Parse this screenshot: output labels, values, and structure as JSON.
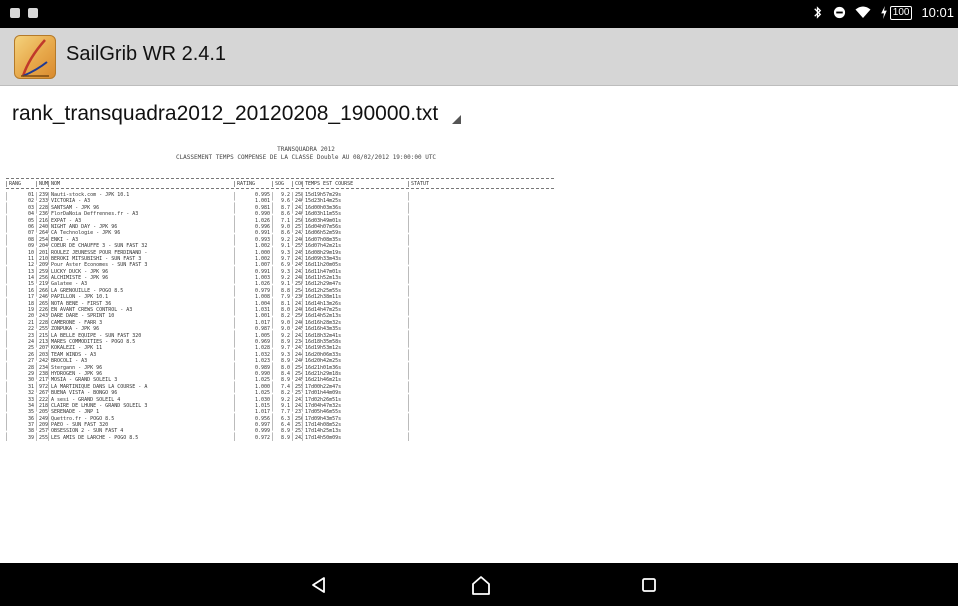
{
  "status_bar": {
    "battery": "100",
    "time": "10:01",
    "icons": [
      "notification-icon",
      "notification-icon",
      "bluetooth-icon",
      "do-not-disturb-icon",
      "wifi-icon",
      "charging-icon"
    ]
  },
  "app": {
    "title": "SailGrib WR 2.4.1",
    "icon": "sailgrib-logo-icon"
  },
  "file_selector": {
    "selected": "rank_transquadra2012_20120208_190000.txt"
  },
  "document": {
    "header": {
      "line1": "TRANSQUADRA 2012",
      "line2": "CLASSEMENT TEMPS COMPENSE DE LA CLASSE Double AU 08/02/2012 19:00:00 UTC"
    },
    "columns": [
      "RANG",
      "NUM",
      "NOM",
      "RATING",
      "SOG",
      "COG",
      "TEMPS EST COURSE",
      "STATUT"
    ],
    "rows": [
      [
        "01",
        "239",
        "Nauti-stock.com     - JPK 10.1",
        "0.995",
        "9.2",
        "258",
        "15d19h57m29s",
        ""
      ],
      [
        "02",
        "233",
        "VICTORIA   - A3",
        "1.001",
        "9.6",
        "246",
        "15d23h14m25s",
        ""
      ],
      [
        "03",
        "228",
        "SANTSAM   - JPK 96",
        "0.981",
        "8.7",
        "243",
        "16d00h03m36s",
        ""
      ],
      [
        "04",
        "236",
        "FlorDaNoia Deffrennes.fr - A3",
        "0.990",
        "8.6",
        "240",
        "16d03h11m55s",
        ""
      ],
      [
        "05",
        "216",
        "EXPAT   - A3",
        "1.026",
        "7.1",
        "250",
        "16d03h49m01s",
        ""
      ],
      [
        "06",
        "240",
        "NIGHT AND DAY   - JPK 96",
        "0.996",
        "9.0",
        "257",
        "16d04h07m56s",
        ""
      ],
      [
        "07",
        "264",
        "CA Technologie - JPK 96",
        "0.991",
        "8.6",
        "242",
        "16d06h52m59s",
        ""
      ],
      [
        "08",
        "254",
        "ENKI   - A3",
        "0.993",
        "9.2",
        "246",
        "16d07h08m35s",
        ""
      ],
      [
        "09",
        "204",
        "COEUR DE CHAUFFE 3 - SUN FAST 32",
        "1.002",
        "9.1",
        "255",
        "16d07h42m21s",
        ""
      ],
      [
        "10",
        "201",
        "ROULEZ JEUNESSE POUR FERDINAND -",
        "1.000",
        "9.3",
        "245",
        "16d08h29m19s",
        ""
      ],
      [
        "11",
        "210",
        "BEROKI MITSUBISHI   - SUN FAST 3",
        "1.002",
        "9.7",
        "243",
        "16d09h33m43s",
        ""
      ],
      [
        "12",
        "209",
        "Pour Aster Economes - SUN FAST 3",
        "1.007",
        "6.9",
        "245",
        "16d11h20m05s",
        ""
      ],
      [
        "13",
        "259",
        "LUCKY DUCK - JPK 96",
        "0.991",
        "9.3",
        "243",
        "16d11h47m01s",
        ""
      ],
      [
        "14",
        "256",
        "ALCHIMISTE   - JPK 96",
        "1.003",
        "9.2",
        "248",
        "16d11h52m13s",
        ""
      ],
      [
        "15",
        "219",
        "Galatee   - A3",
        "1.026",
        "9.1",
        "258",
        "16d12h29m47s",
        ""
      ],
      [
        "16",
        "266",
        "LA GRENOUILLE - POGO 8.5",
        "0.979",
        "8.8",
        "254",
        "16d12h25m55s",
        ""
      ],
      [
        "17",
        "246",
        "PAPILLON   - JPK 10.1",
        "1.008",
        "7.9",
        "236",
        "16d12h38m11s",
        ""
      ],
      [
        "18",
        "265",
        "NOTA BENE - FIRST 36",
        "1.004",
        "8.1",
        "241",
        "16d14h13m26s",
        ""
      ],
      [
        "19",
        "226",
        "EN AVANT CREWS CONTROL - A3",
        "1.031",
        "8.0",
        "240",
        "16d14h47m25s",
        ""
      ],
      [
        "20",
        "243",
        "DARE DARE - SPRINT 10",
        "1.001",
        "8.2",
        "256",
        "16d14h52m13s",
        ""
      ],
      [
        "21",
        "228",
        "CAMERONE   - FARR 3",
        "1.017",
        "9.0",
        "246",
        "16d16h28m32s",
        ""
      ],
      [
        "22",
        "255",
        "ZONPUKA   - JPK 96",
        "0.987",
        "9.0",
        "245",
        "16d16h43m35s",
        ""
      ],
      [
        "23",
        "215",
        "LA BELLE EQUIPE - SUN FAST 320",
        "1.005",
        "9.2",
        "242",
        "16d18h32m41s",
        ""
      ],
      [
        "24",
        "213",
        "MARES COMMODITIES - POGO 8.5",
        "0.969",
        "8.9",
        "234",
        "16d18h35m58s",
        ""
      ],
      [
        "25",
        "207",
        "KOKALEZI   - JPK 11",
        "1.028",
        "9.7",
        "243",
        "16d19h53m12s",
        ""
      ],
      [
        "26",
        "203",
        "TEAM WINDS - A3",
        "1.032",
        "9.3",
        "244",
        "16d20h06m33s",
        ""
      ],
      [
        "27",
        "242",
        "BROCOLI   - A3",
        "1.023",
        "8.9",
        "246",
        "16d20h42m25s",
        ""
      ],
      [
        "28",
        "234",
        "Stergann   - JPK 96",
        "0.989",
        "8.0",
        "254",
        "16d21h01m36s",
        ""
      ],
      [
        "29",
        "238",
        "HYDROGEN   - JPK 96",
        "0.990",
        "8.4",
        "254",
        "16d21h29m18s",
        ""
      ],
      [
        "30",
        "217",
        "MOSIA   - GRAND SOLEIL 3",
        "1.025",
        "8.9",
        "245",
        "16d21h46m21s",
        ""
      ],
      [
        "31",
        "972",
        "LA MARTINIQUE DANS LA COURSE - A",
        "1.000",
        "7.4",
        "255",
        "17d00h22m47s",
        ""
      ],
      [
        "32",
        "267",
        "BUENA VISTA   - BONGO 96",
        "1.025",
        "8.2",
        "257",
        "17d01h44m09s",
        ""
      ],
      [
        "33",
        "222",
        "A sesi - GRAND SOLEIL 4",
        "1.030",
        "9.2",
        "243",
        "17d02h26m51s",
        ""
      ],
      [
        "34",
        "218",
        "CLAIRE DE LHUNE - GRAND SOLEIL 3",
        "1.015",
        "9.1",
        "242",
        "17d04h47m32s",
        ""
      ],
      [
        "35",
        "205",
        "SERENADE   - JNP 1",
        "1.017",
        "7.7",
        "237",
        "17d05h46m55s",
        ""
      ],
      [
        "36",
        "249",
        "Quettro.fr - POGO 8.5",
        "0.956",
        "6.3",
        "256",
        "17d09h43m57s",
        ""
      ],
      [
        "37",
        "209",
        "PAEO   - SUN FAST 320",
        "0.997",
        "6.4",
        "251",
        "17d14h08m52s",
        ""
      ],
      [
        "38",
        "257",
        "OBSESSION 2 - SUN FAST 4",
        "0.999",
        "8.9",
        "253",
        "17d14h25m13s",
        ""
      ],
      [
        "39",
        "255",
        "LES AMIS DE LARCHE - POGO 8.5",
        "0.972",
        "8.9",
        "242",
        "17d14h50m09s",
        ""
      ]
    ]
  },
  "nav_bar": {
    "buttons": [
      "back-icon",
      "home-icon",
      "recents-icon"
    ]
  }
}
